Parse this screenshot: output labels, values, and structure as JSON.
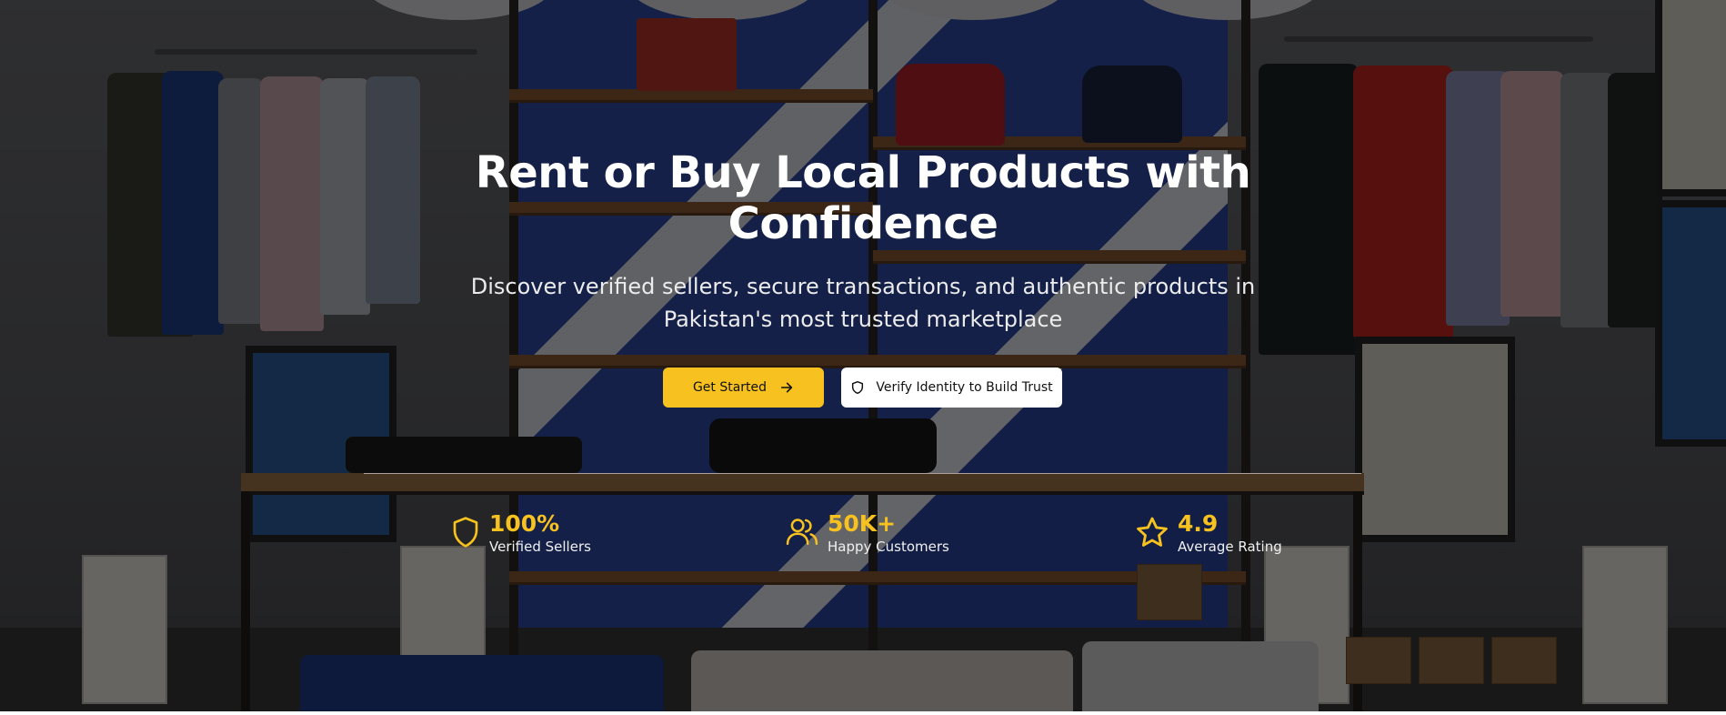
{
  "hero": {
    "headline": "Rent or Buy Local Products with Confidence",
    "subheadline": "Discover verified sellers, secure transactions, and authentic products in Pakistan's most trusted marketplace",
    "primary_button": {
      "label": "Get Started",
      "icon": "arrow-right-icon"
    },
    "secondary_button": {
      "label": "Verify Identity to Build Trust",
      "icon": "shield-icon"
    },
    "stats": [
      {
        "value": "100%",
        "label": "Verified Sellers",
        "icon": "shield-icon"
      },
      {
        "value": "50K+",
        "label": "Happy Customers",
        "icon": "users-icon"
      },
      {
        "value": "4.9",
        "label": "Average Rating",
        "icon": "star-icon"
      }
    ]
  },
  "colors": {
    "accent": "#f7c21f",
    "overlay": "#000000",
    "text_primary": "#ffffff"
  }
}
